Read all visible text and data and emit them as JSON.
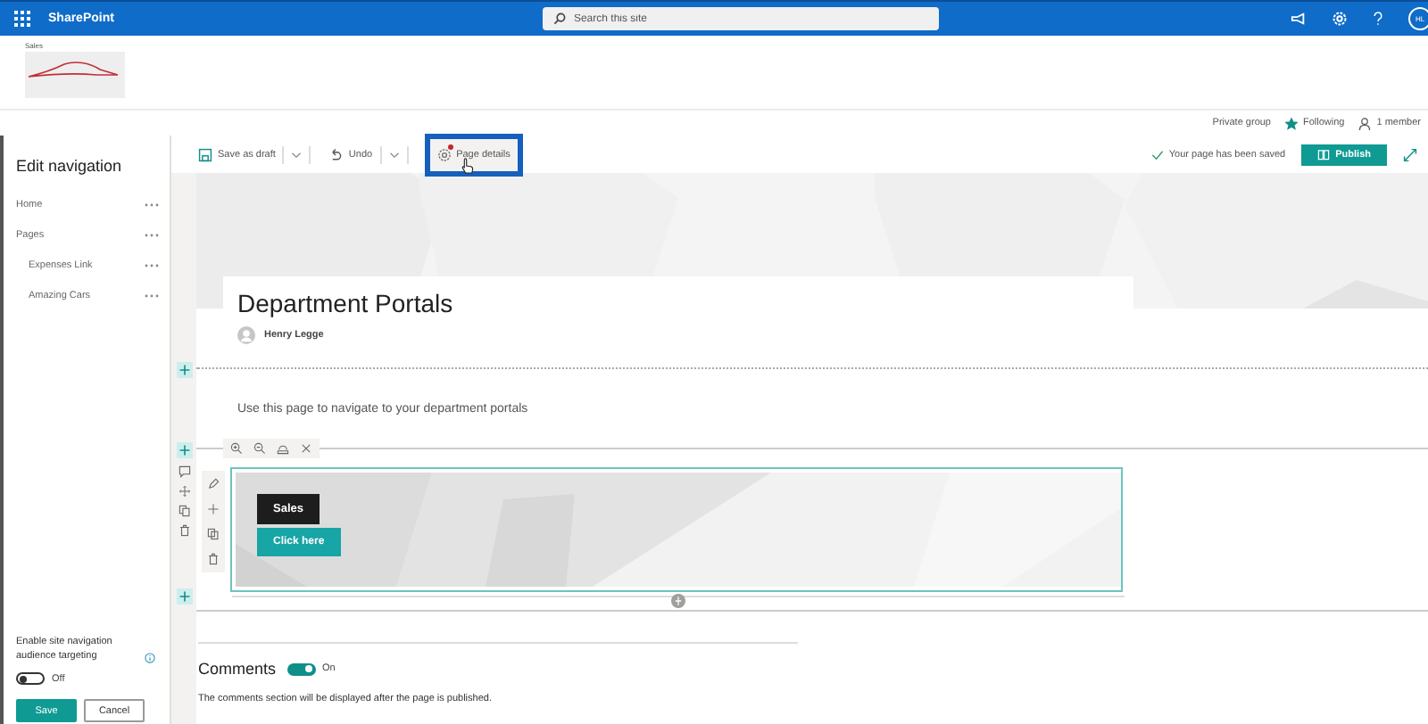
{
  "top_bar": {
    "app_name": "SharePoint",
    "search": {
      "placeholder": "Search this site"
    },
    "avatar": "HL"
  },
  "site_header": {
    "site_name": "Sales",
    "privacy": "Private group",
    "follow": {
      "label": "Following",
      "following": true
    },
    "members": "1 member"
  },
  "nav_panel": {
    "title": "Edit navigation",
    "items": [
      {
        "label": "Home"
      },
      {
        "label": "Pages",
        "children": [
          {
            "label": "Expenses Link"
          },
          {
            "label": "Amazing Cars"
          }
        ]
      }
    ],
    "audience_targeting": {
      "label": "Enable site navigation audience targeting",
      "on": false,
      "state_text": "Off"
    },
    "buttons": [
      {
        "label": "Save",
        "kind": "primary"
      },
      {
        "label": "Cancel",
        "kind": "secondary"
      }
    ]
  },
  "command_bar": {
    "items": [
      {
        "label": "Save as draft",
        "kind": "save",
        "split": true,
        "highlighted": false
      },
      {
        "label": "Undo",
        "kind": "undo",
        "split": true,
        "highlighted": false
      },
      {
        "label": "Page details",
        "kind": "details",
        "split": false,
        "highlighted": true
      }
    ],
    "status": "Your page has been saved",
    "publish": "Publish"
  },
  "page": {
    "title": "Department Portals",
    "author": "Henry Legge",
    "text": "Use this page to navigate to your department portals",
    "hero": {
      "label": "Sales",
      "button": "Click here"
    },
    "comments": {
      "title": "Comments",
      "on": true,
      "state_text": "On",
      "note": "The comments section will be displayed after the page is published."
    }
  }
}
